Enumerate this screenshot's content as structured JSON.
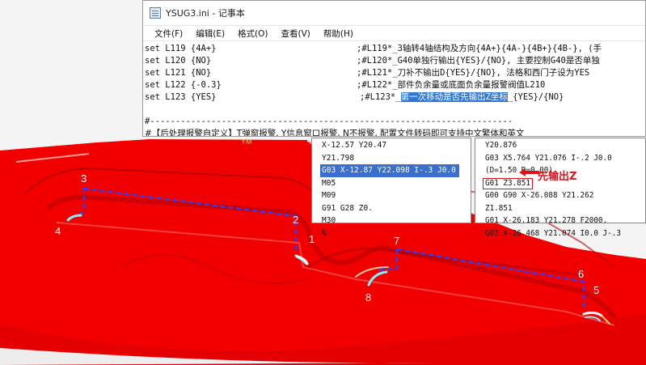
{
  "notepad": {
    "title": "YSUG3.ini - 记事本",
    "menu": [
      "文件(F)",
      "编辑(E)",
      "格式(O)",
      "查看(V)",
      "帮助(H)"
    ],
    "lines": [
      {
        "key": "set L119 {4A+}",
        "comment": ";#L119*_3轴转4轴结构及方向{4A+}{4A-}{4B+}{4B-}, (手"
      },
      {
        "key": "set L120 {NO}",
        "comment": ";#L120*_G40单独行输出{YES}/{NO}, 主要控制G40是否单独"
      },
      {
        "key": "set L121 {NO}",
        "comment": ";#L121*_刀补不输出D{YES}/{NO}, 法格和西门子设为YES"
      },
      {
        "key": "set L122 {-0.3}",
        "comment": ";#L122*_部件负余量或底面负余量报警阀值L210"
      },
      {
        "key": "set L123 {YES}",
        "comment_pre": ";#L123*_",
        "comment_hl": "第一次移动是否先输出Z坐标",
        "comment_post": "_{YES}/{NO}"
      }
    ],
    "sep1": "#-----------------------------------------------------------------------",
    "alarm_line": "#【后处理报警自定义】T弹窗报警, Y信息窗口报警, N不报警, 配置文件转码即可支持中文繁体和英文",
    "sep2": "#-----------------------------------------------------------------------"
  },
  "gcode_left": {
    "lines": [
      "X-12.57 Y20.47",
      "Y21.798",
      "G03 X-12.87 Y22.098 I-.3 J0.0",
      "M05",
      "M09",
      "G91 G28 Z0.",
      "M30",
      "%"
    ],
    "selected_index": 2
  },
  "gcode_right": {
    "lines": [
      "Y20.876",
      "G03 X5.764 Y21.076 I-.2 J0.0",
      "(D=1.50 R=0.00)",
      "G01 Z3.851",
      "G00 G90 X-26.088 Y21.262",
      "Z1.851",
      "G01 X-26.183 Y21.278 F2000.",
      "G03 X-26.468 Y21.074 I0.0 J-.3"
    ],
    "boxed_index": 3,
    "annotation": "先输出Z"
  },
  "toolpath_labels": [
    "1",
    "2",
    "3",
    "4",
    "5",
    "6",
    "7",
    "8"
  ],
  "watermark": "YM",
  "colors": {
    "part": "#f00000",
    "toolpath": "#2a40ff",
    "selection": "#3a6fd1",
    "arrow": "#e0101a"
  }
}
